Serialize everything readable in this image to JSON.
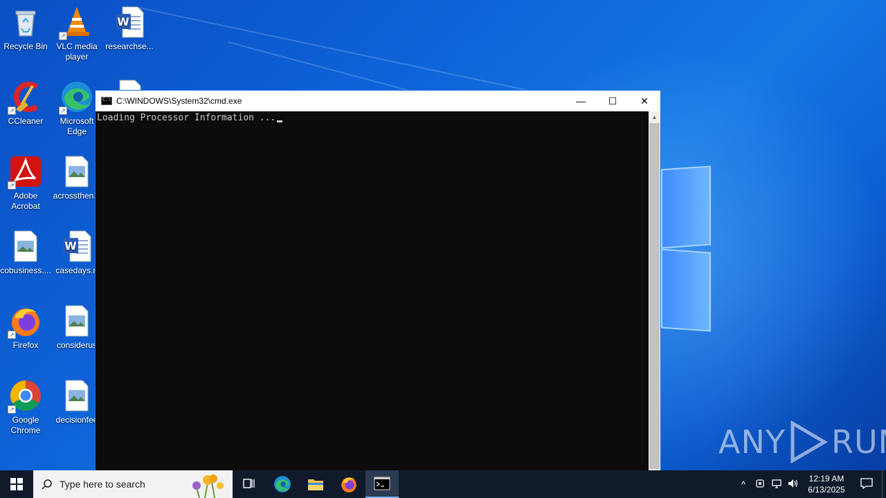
{
  "desktop": {
    "icons": [
      {
        "label": "Recycle Bin"
      },
      {
        "label": "VLC media player"
      },
      {
        "label": "researchse..."
      },
      {
        "label": "CCleaner"
      },
      {
        "label": "Microsoft Edge"
      },
      {
        "label": "Adobe Acrobat"
      },
      {
        "label": "acrossthen..."
      },
      {
        "label": "cobusiness...."
      },
      {
        "label": "casedays.rt"
      },
      {
        "label": "Firefox"
      },
      {
        "label": "considerus"
      },
      {
        "label": "Google Chrome"
      },
      {
        "label": "decisionfee"
      }
    ]
  },
  "cmd_window": {
    "title": "C:\\WINDOWS\\System32\\cmd.exe",
    "output": "Loading Processor Information ...",
    "minimize": "—",
    "maximize": "☐",
    "close": "✕"
  },
  "taskbar": {
    "search_placeholder": "Type here to search",
    "clock_time": "12:19 AM",
    "clock_date": "6/13/2025"
  },
  "watermark": {
    "text_left": "ANY",
    "text_right": "RUN"
  }
}
